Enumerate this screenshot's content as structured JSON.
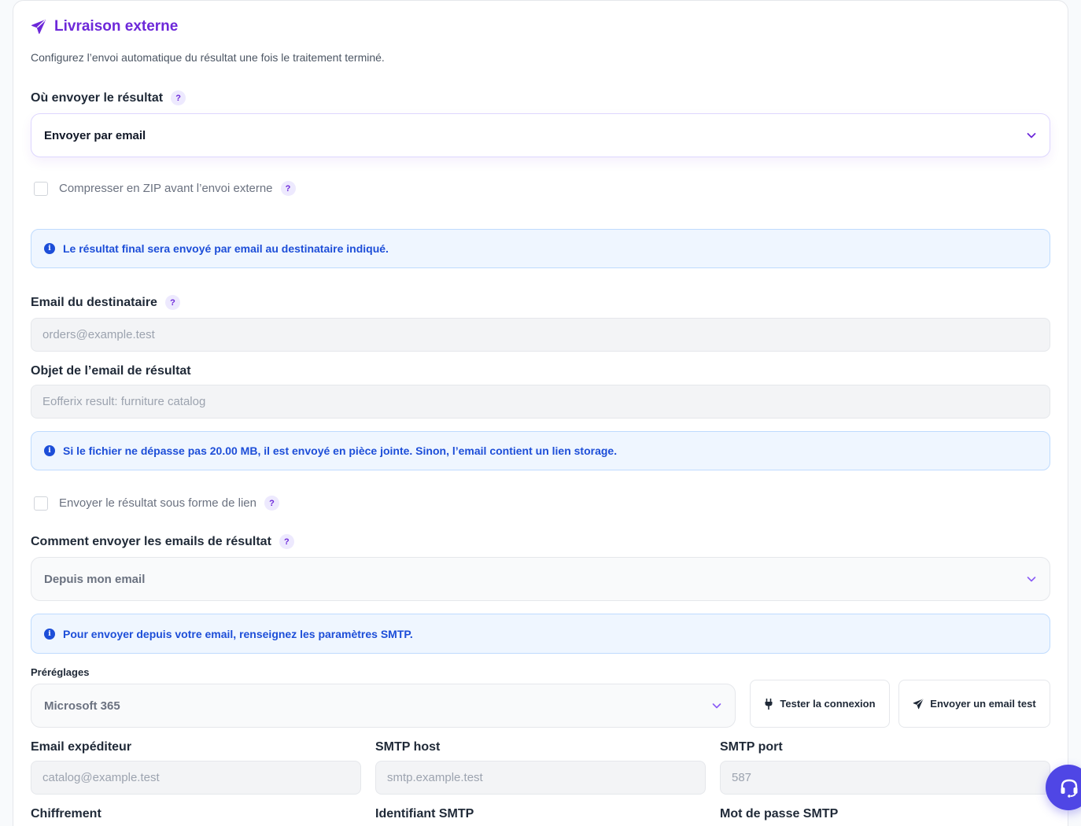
{
  "section": {
    "title": "Livraison externe",
    "subtitle": "Configurez l’envoi automatique du résultat une fois le traitement terminé."
  },
  "destination": {
    "label": "Où envoyer le résultat",
    "help": "?",
    "selected": "Envoyer par email"
  },
  "zip": {
    "label": "Compresser en ZIP avant l’envoi externe",
    "help": "?",
    "checked": false
  },
  "info_email": "Le résultat final sera envoyé par email au destinataire indiqué.",
  "recipient": {
    "label": "Email du destinataire",
    "help": "?",
    "placeholder": "orders@example.test"
  },
  "subject": {
    "label": "Objet de l’email de résultat",
    "placeholder": "Eofferix result: furniture catalog"
  },
  "info_attachment": "Si le fichier ne dépasse pas 20.00 MB, il est envoyé en pièce jointe. Sinon, l’email contient un lien storage.",
  "send_link": {
    "label": "Envoyer le résultat sous forme de lien",
    "help": "?",
    "checked": false
  },
  "send_method": {
    "label": "Comment envoyer les emails de résultat",
    "help": "?",
    "selected": "Depuis mon email"
  },
  "info_smtp": "Pour envoyer depuis votre email, renseignez les paramètres SMTP.",
  "presets": {
    "label": "Préréglages",
    "selected": "Microsoft 365"
  },
  "buttons": {
    "test_connection": "Tester la connexion",
    "send_test": "Envoyer un email test"
  },
  "smtp": {
    "sender_label": "Email expéditeur",
    "sender_placeholder": "catalog@example.test",
    "host_label": "SMTP host",
    "host_placeholder": "smtp.example.test",
    "port_label": "SMTP port",
    "port_placeholder": "587",
    "encryption_label": "Chiffrement",
    "username_label": "Identifiant SMTP",
    "password_label": "Mot de passe SMTP"
  },
  "icons": {
    "title": "paper-plane-icon",
    "chevron": "chevron-down-icon",
    "info": "info-icon",
    "test": "plug-icon",
    "send": "paper-plane-icon",
    "support": "headset-icon"
  },
  "colors": {
    "accent": "#6d28d9",
    "info_text": "#1d4ed8",
    "info_bg": "#eff6ff",
    "support_fab": "#4f46e5"
  }
}
